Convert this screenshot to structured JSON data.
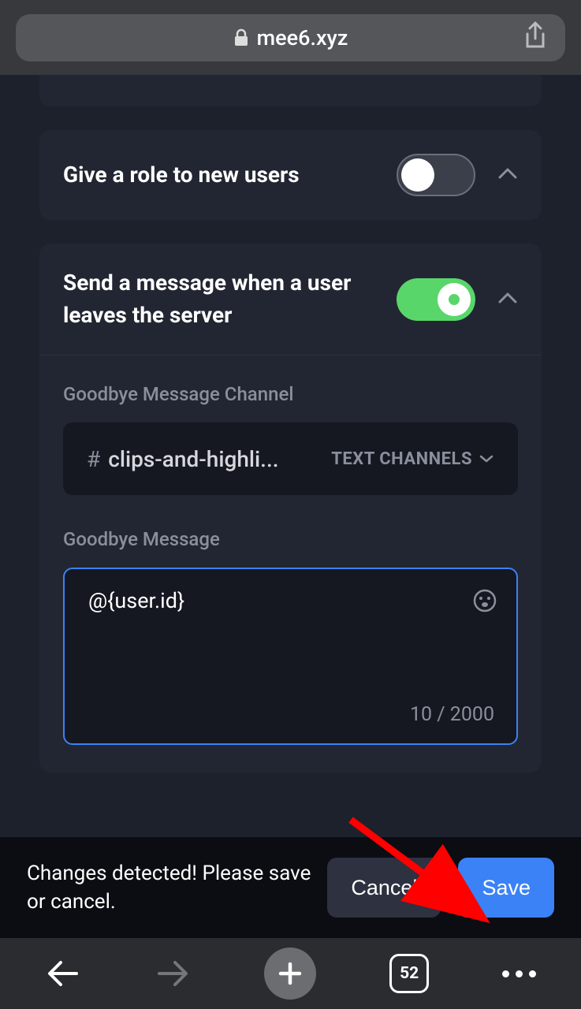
{
  "browser": {
    "url": "mee6.xyz",
    "tab_count": "52"
  },
  "settings": {
    "give_role": {
      "title": "Give a role to new users",
      "enabled": false
    },
    "goodbye": {
      "title": "Send a message when a user leaves the server",
      "enabled": true,
      "channel_label": "Goodbye Message Channel",
      "channel_name": "clips-and-highli...",
      "channel_type": "TEXT CHANNELS",
      "message_label": "Goodbye Message",
      "message_content": "@{user.id}",
      "char_count": "10 / 2000"
    }
  },
  "changes_bar": {
    "text": "Changes detected! Please save or cancel.",
    "cancel": "Cancel",
    "save": "Save"
  }
}
